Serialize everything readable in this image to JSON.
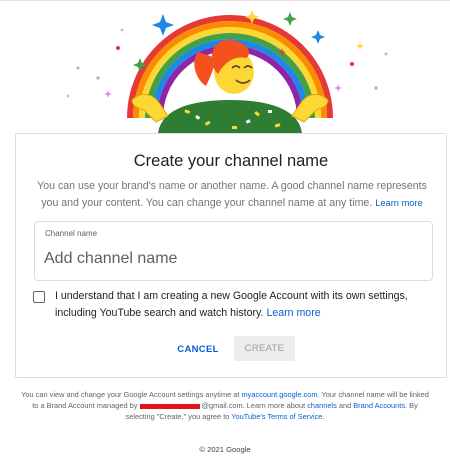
{
  "dialog": {
    "title": "Create your channel name",
    "description": "You can use your brand's name or another name. A good channel name represents you and your content. You can change your channel name at any time.",
    "learn_more": "Learn more",
    "field_label": "Channel name",
    "field_placeholder": "Add channel name",
    "field_value": "",
    "checkbox_checked": false,
    "agreement_text": "I understand that I am creating a new Google Account with its own settings, including YouTube search and watch history.",
    "agreement_learn_more": "Learn more",
    "cancel_label": "CANCEL",
    "create_label": "CREATE"
  },
  "footer": {
    "line1_prefix": "You can view and change your Google Account settings anytime at",
    "account_link": "myaccount.google.com",
    "line2_prefix": "Your channel name will be linked to a Brand Account managed by",
    "email_suffix": "@gmail.com",
    "line2_suffix": "Learn more about",
    "channels_link": "channels",
    "and": "and",
    "brand_accounts_link": "Brand Accounts",
    "line3": "By selecting \"Create,\" you agree to",
    "terms_link": "YouTube's Terms of Service",
    "copyright": "© 2021 Google"
  },
  "colors": {
    "link": "#065fd4",
    "title": "#202124",
    "muted": "#70757a",
    "redaction": "#e0121e"
  },
  "icons": {
    "illustration": "rainbow-person-confetti",
    "checkbox": "unchecked-checkbox"
  }
}
